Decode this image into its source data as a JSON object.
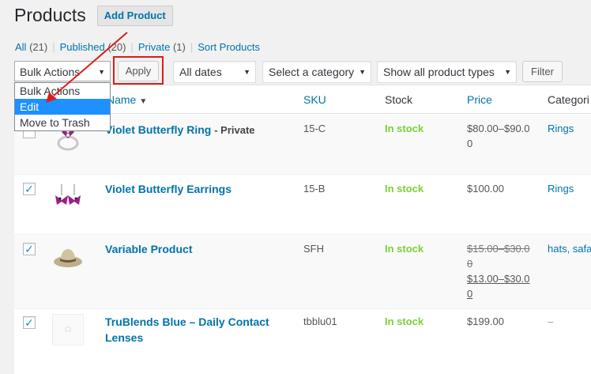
{
  "header": {
    "title": "Products",
    "add_button": "Add Product"
  },
  "views": {
    "all": "All",
    "all_count": "(21)",
    "published": "Published",
    "published_count": "(20)",
    "private": "Private",
    "private_count": "(1)",
    "sort": "Sort Products",
    "separator": "|"
  },
  "tablenav": {
    "bulk_actions": "Bulk Actions",
    "apply": "Apply",
    "dates": "All dates",
    "category": "Select a category",
    "types": "Show all product types",
    "filter": "Filter"
  },
  "bulk_dropdown": {
    "options": [
      "Bulk Actions",
      "Edit",
      "Move to Trash"
    ],
    "selected_index": 1
  },
  "columns": {
    "name": "Name",
    "sku": "SKU",
    "stock": "Stock",
    "price": "Price",
    "categories": "Categori"
  },
  "rows": [
    {
      "name": "Violet Butterfly Ring",
      "private_label": "- Private",
      "sku": "15-C",
      "stock": "In stock",
      "price_line1": "$80.00–$90.0",
      "price_line2": "0",
      "category": "Rings",
      "checked": false,
      "thumb": "ring"
    },
    {
      "name": "Violet Butterfly Earrings",
      "sku": "15-B",
      "stock": "In stock",
      "price_line1": "$100.00",
      "category": "Rings",
      "checked": true,
      "thumb": "earrings"
    },
    {
      "name": "Variable Product",
      "sku": "SFH",
      "stock": "In stock",
      "price_old_line1": "$15.00–$30.0",
      "price_old_line2": "0",
      "price_new_line1": "$13.00–$30.0",
      "price_new_line2": "0",
      "category": "hats, safa",
      "checked": true,
      "thumb": "hat"
    },
    {
      "name_line1": "TruBlends Blue – Daily Contact",
      "name_line2": "Lenses",
      "sku": "tbblu01",
      "stock": "In stock",
      "price_line1": "$199.00",
      "category": "–",
      "checked": true,
      "thumb": "placeholder"
    }
  ],
  "check_mark": "✓",
  "colors": {
    "link": "#0073aa",
    "in_stock": "#7ad03a",
    "highlight": "#dd1c1c",
    "dropdown_selected": "#1e90ff"
  }
}
